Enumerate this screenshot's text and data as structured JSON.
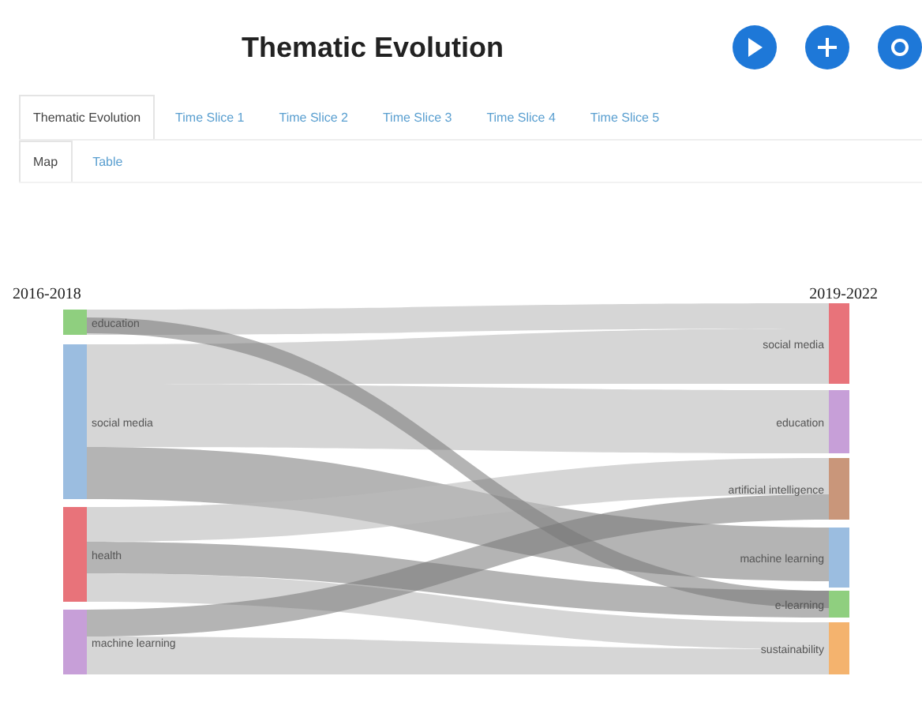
{
  "header": {
    "title": "Thematic Evolution"
  },
  "toolbar": [
    {
      "kind": "play"
    },
    {
      "kind": "add"
    },
    {
      "kind": "other"
    }
  ],
  "tabs": [
    {
      "label": "Thematic Evolution",
      "selected": true
    },
    {
      "label": "Time Slice 1",
      "selected": false
    },
    {
      "label": "Time Slice 2",
      "selected": false
    },
    {
      "label": "Time Slice 3",
      "selected": false
    },
    {
      "label": "Time Slice 4",
      "selected": false
    },
    {
      "label": "Time Slice 5",
      "selected": false
    }
  ],
  "subtabs": [
    {
      "label": "Map",
      "selected": true
    },
    {
      "label": "Table",
      "selected": false
    }
  ],
  "sankey": {
    "left_period": "2016-2018",
    "right_period": "2019-2022",
    "left_nodes": [
      {
        "label": "education",
        "color": "#8fcf7f"
      },
      {
        "label": "social media",
        "color": "#9bbde0"
      },
      {
        "label": "health",
        "color": "#e8737a"
      },
      {
        "label": "machine learning",
        "color": "#c79fd8"
      }
    ],
    "right_nodes": [
      {
        "label": "social media",
        "color": "#e8737a"
      },
      {
        "label": "education",
        "color": "#c79fd8"
      },
      {
        "label": "artificial intelligence",
        "color": "#c9967a"
      },
      {
        "label": "machine learning",
        "color": "#9bbde0"
      },
      {
        "label": "e-learning",
        "color": "#8fcf7f"
      },
      {
        "label": "sustainability",
        "color": "#f4b36e"
      }
    ]
  }
}
